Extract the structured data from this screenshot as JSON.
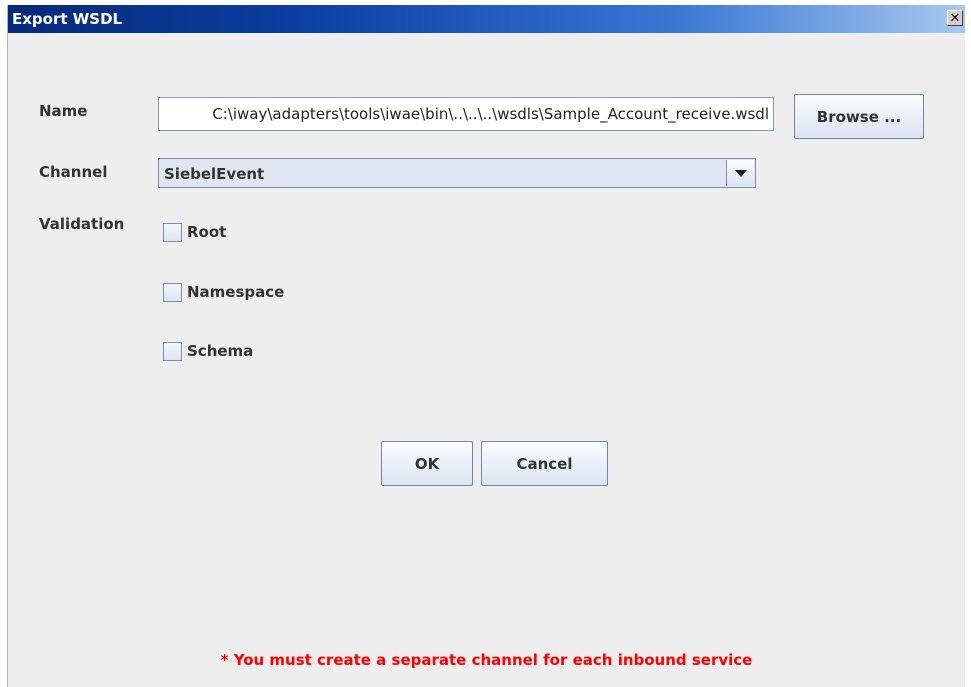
{
  "window": {
    "title": "Export WSDL",
    "close_symbol": "✕"
  },
  "form": {
    "name_label": "Name",
    "name_value": "C:\\iway\\adapters\\tools\\iwae\\bin\\..\\..\\..\\wsdls\\Sample_Account_receive.wsdl",
    "browse_label": "Browse ...",
    "channel_label": "Channel",
    "channel_value": "SiebelEvent",
    "validation_label": "Validation",
    "validation_options": [
      {
        "label": "Root",
        "checked": false
      },
      {
        "label": "Namespace",
        "checked": false
      },
      {
        "label": "Schema",
        "checked": false
      }
    ]
  },
  "buttons": {
    "ok": "OK",
    "cancel": "Cancel"
  },
  "note": "* You must create a separate channel for each inbound service",
  "icons": {
    "close": "close-icon",
    "dropdown": "chevron-down-icon"
  },
  "colors": {
    "note": "#ff0000",
    "titlebar_start": "#062a7a",
    "titlebar_end": "#a7c9ef"
  }
}
